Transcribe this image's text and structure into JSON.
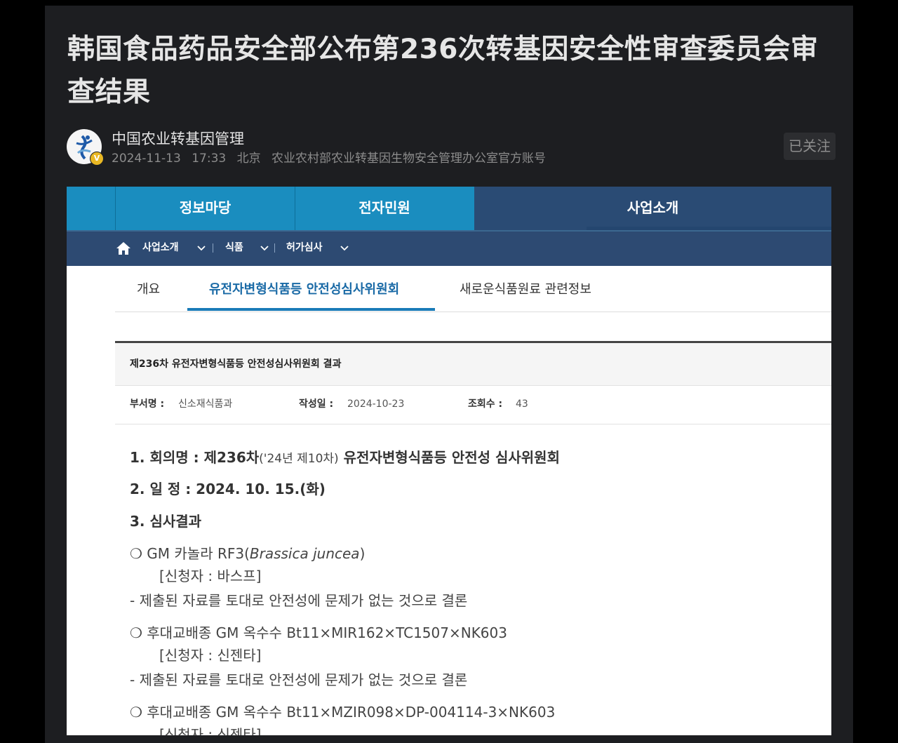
{
  "article": {
    "title": "韩国食品药品安全部公布第236次转基因安全性审查委员会审查结果",
    "author_name": "中国农业转基因管理",
    "date": "2024-11-13",
    "time": "17:33",
    "location": "北京",
    "account_desc": "农业农村部农业转基因生物安全管理办公室官方账号",
    "follow_label": "已关注",
    "verify_badge": "V"
  },
  "screenshot": {
    "gnb_tabs": [
      "정보마당",
      "전자민원",
      "사업소개"
    ],
    "breadcrumb": [
      "사업소개",
      "식품",
      "허가심사"
    ],
    "content_tabs": [
      "개요",
      "유전자변형식품등 안전성심사위원회",
      "새로운식품원료 관련정보"
    ],
    "board_title": "제236차 유전자변형식품등 안전성심사위원회 결과",
    "meta": {
      "dept_label": "부서명 :",
      "dept_value": "신소재식품과",
      "date_label": "작성일 :",
      "date_value": "2024-10-23",
      "views_label": "조회수 :",
      "views_value": "43"
    },
    "body": {
      "l1_a": "1. 회의명 : 제236차",
      "l1_b": "('24년 제10차)",
      "l1_c": " 유전자변형식품등 안전성 심사위원회",
      "l2": "2. 일  정 : 2024. 10. 15.(화)",
      "l3": "3. 심사결과",
      "item1_a": "❍ GM 카놀라 RF3(",
      "item1_b": "Brassica juncea",
      "item1_c": ")",
      "item1_app": "[신청자 : 바스프]",
      "conclusion1": "- 제출된 자료를 토대로 안전성에 문제가 없는 것으로 결론",
      "item2": "❍ 후대교배종 GM 옥수수 Bt11×MIR162×TC1507×NK603",
      "item2_app": "[신청자 : 신젠타]",
      "conclusion2": "- 제출된 자료를 토대로 안전성에 문제가 없는 것으로 결론",
      "item3": "❍ 후대교배종 GM 옥수수 Bt11×MZIR098×DP-004114-3×NK603",
      "item3_app": "[신청자 : 신젠타]"
    }
  },
  "colors": {
    "page_bg": "#1d1e21",
    "gnb_blue": "#1a8dbf",
    "gnb_navy": "#2a4b74",
    "active_tab": "#1a6aa6"
  }
}
